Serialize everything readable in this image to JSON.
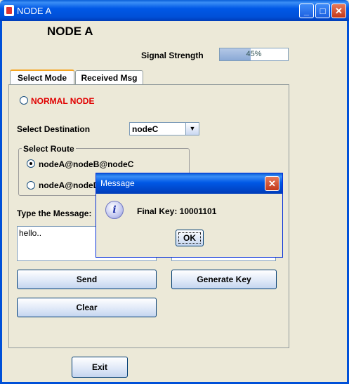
{
  "window": {
    "title": "NODE A",
    "controls": {
      "minimize": "_",
      "maximize": "□",
      "close": "✕"
    }
  },
  "heading": "NODE A",
  "signal": {
    "label": "Signal Strength",
    "value_text": "45%",
    "value": 0.45
  },
  "tabs": [
    {
      "label": "Select Mode",
      "active": true
    },
    {
      "label": "Received Msg",
      "active": false
    }
  ],
  "mode": {
    "normal_node_label": "NORMAL NODE",
    "normal_node_color": "#e00000"
  },
  "destination": {
    "label": "Select Destination",
    "selected": "nodeC",
    "arrow": "▼"
  },
  "route": {
    "title": "Select Route",
    "options": [
      {
        "label": "nodeA@nodeB@nodeC",
        "checked": true
      },
      {
        "label": "nodeA@nodeD",
        "checked": false
      }
    ]
  },
  "message": {
    "label": "Type the Message:",
    "value": "hello.."
  },
  "buttons": {
    "send": "Send",
    "generate_key": "Generate Key",
    "clear": "Clear",
    "exit": "Exit"
  },
  "dialog": {
    "title": "Message",
    "icon": "info-icon",
    "icon_glyph": "i",
    "text": "Final Key: 10001101",
    "ok": "OK",
    "close": "✕"
  },
  "colors": {
    "titlebar": "#0058e6",
    "background": "#ece9d8",
    "accent_tab": "#f5a623"
  }
}
